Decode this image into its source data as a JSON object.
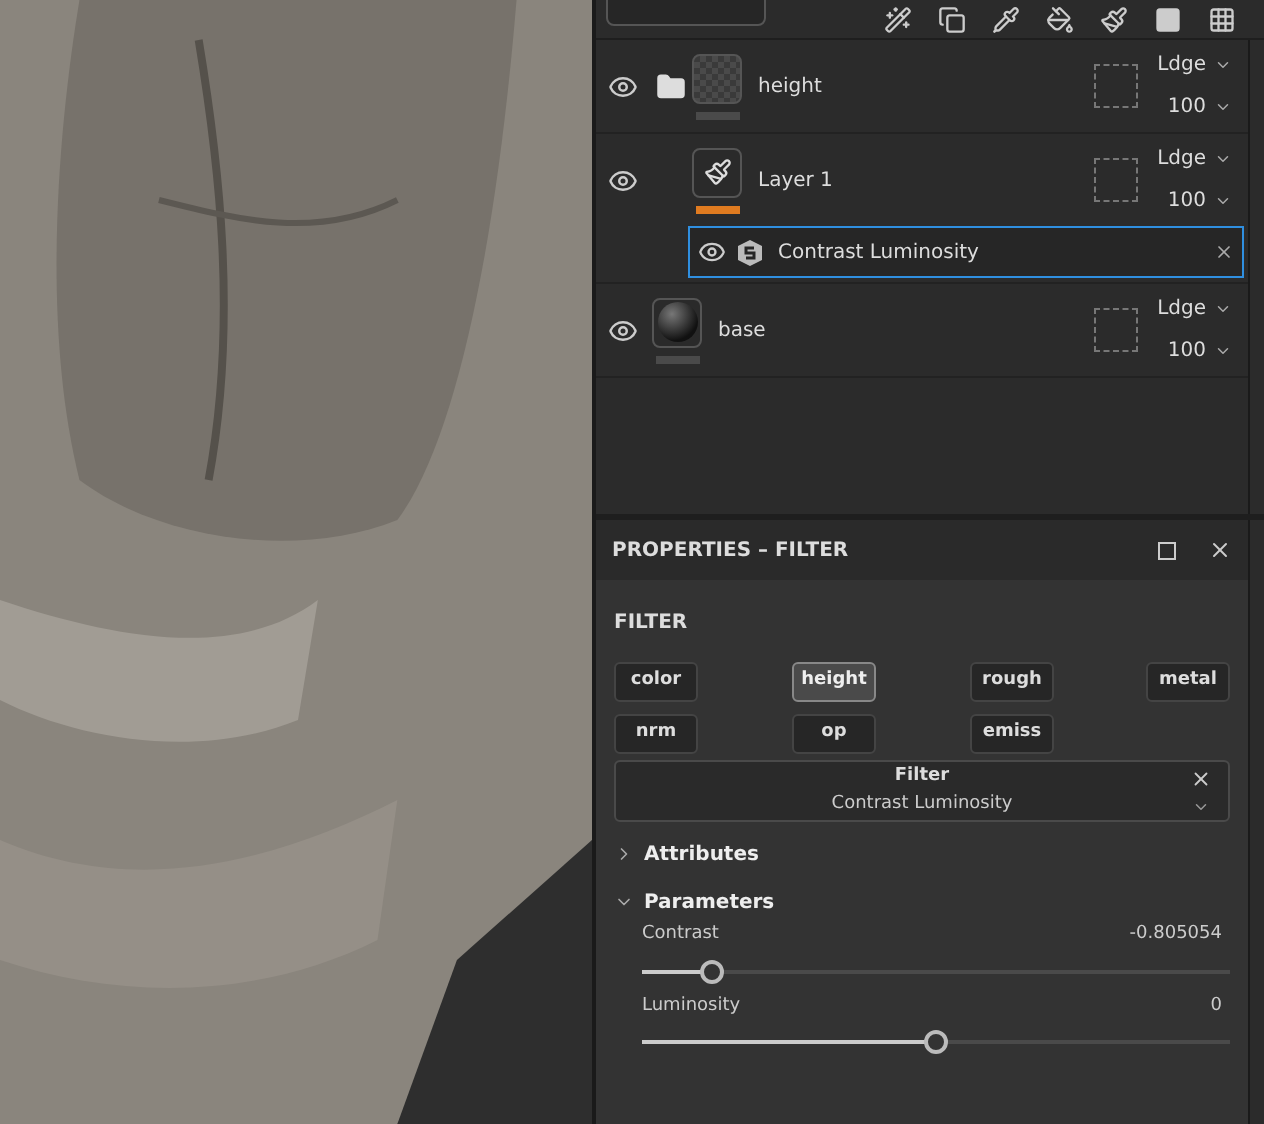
{
  "layers": [
    {
      "name": "height",
      "kind": "folder",
      "visible": true,
      "color": "#4a4a4a",
      "blend": "Ldge",
      "opacity": "100"
    },
    {
      "name": "Layer 1",
      "kind": "paint",
      "visible": true,
      "color": "#e07b20",
      "blend": "Ldge",
      "opacity": "100",
      "filters": [
        {
          "name": "Contrast Luminosity",
          "visible": true,
          "selected": true
        }
      ]
    },
    {
      "name": "base",
      "kind": "fill",
      "visible": true,
      "color": "#4a4a4a",
      "blend": "Ldge",
      "opacity": "100"
    }
  ],
  "properties": {
    "title": "PROPERTIES – FILTER",
    "section": "FILTER",
    "channels": [
      {
        "label": "color",
        "selected": false
      },
      {
        "label": "height",
        "selected": true
      },
      {
        "label": "rough",
        "selected": false
      },
      {
        "label": "metal",
        "selected": false
      },
      {
        "label": "nrm",
        "selected": false
      },
      {
        "label": "op",
        "selected": false
      },
      {
        "label": "emiss",
        "selected": false
      }
    ],
    "filter": {
      "label": "Filter",
      "value": "Contrast Luminosity"
    },
    "groups": [
      {
        "title": "Attributes",
        "expanded": false
      },
      {
        "title": "Parameters",
        "expanded": true,
        "params": [
          {
            "name": "Contrast",
            "value": "-0.805054",
            "level": 0.12
          },
          {
            "name": "Luminosity",
            "value": "0",
            "level": 0.5
          }
        ]
      }
    ]
  }
}
